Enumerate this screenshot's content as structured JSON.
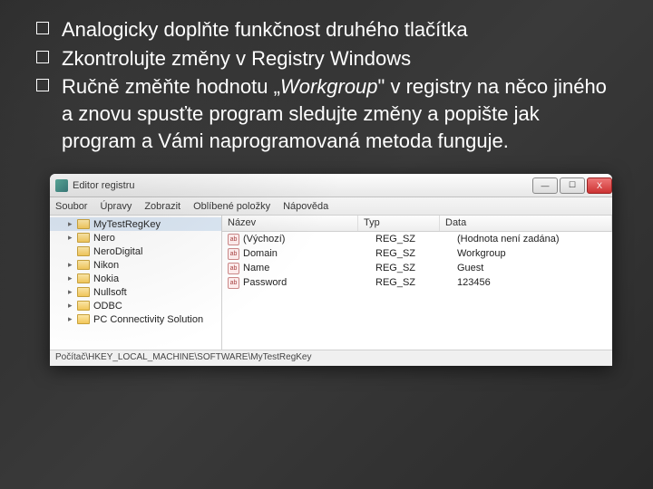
{
  "bullets": {
    "b1": "Analogicky doplňte funkčnost druhého tlačítka",
    "b2": "Zkontrolujte změny v Registry Windows",
    "b3a": "Ručně změňte hodnotu ",
    "b3_q1": "„",
    "b3_workgroup": "Workgroup",
    "b3_q2": "\"",
    "b3c": " v registry na něco jiného a znovu spusťte program sledujte změny a popište jak program a Vámi naprogramovaná metoda funguje."
  },
  "regedit": {
    "title": "Editor registru",
    "menu": [
      "Soubor",
      "Úpravy",
      "Zobrazit",
      "Oblíbené položky",
      "Nápověda"
    ],
    "winbtns": {
      "min": "—",
      "max": "☐",
      "close": "X"
    },
    "tree": [
      {
        "label": "MyTestRegKey",
        "exp": "▸"
      },
      {
        "label": "Nero",
        "exp": "▸"
      },
      {
        "label": "NeroDigital",
        "exp": ""
      },
      {
        "label": "Nikon",
        "exp": "▸"
      },
      {
        "label": "Nokia",
        "exp": "▸"
      },
      {
        "label": "Nullsoft",
        "exp": "▸"
      },
      {
        "label": "ODBC",
        "exp": "▸"
      },
      {
        "label": "PC Connectivity Solution",
        "exp": "▸"
      }
    ],
    "cols": {
      "name": "Název",
      "type": "Typ",
      "data": "Data"
    },
    "rows": [
      {
        "name": "(Výchozí)",
        "type": "REG_SZ",
        "data": "(Hodnota není zadána)"
      },
      {
        "name": "Domain",
        "type": "REG_SZ",
        "data": "Workgroup"
      },
      {
        "name": "Name",
        "type": "REG_SZ",
        "data": "Guest"
      },
      {
        "name": "Password",
        "type": "REG_SZ",
        "data": "123456"
      }
    ],
    "status": "Počítač\\HKEY_LOCAL_MACHINE\\SOFTWARE\\MyTestRegKey"
  }
}
